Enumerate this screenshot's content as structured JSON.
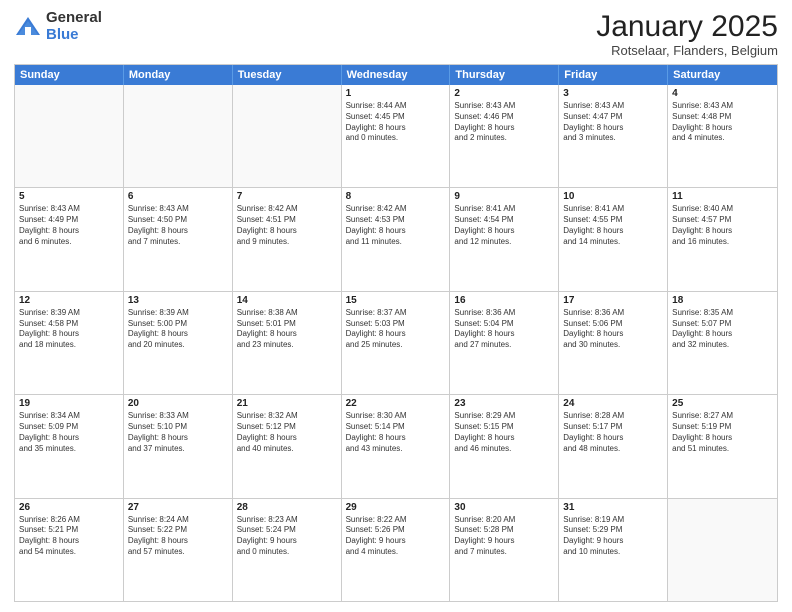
{
  "logo": {
    "general": "General",
    "blue": "Blue"
  },
  "header": {
    "month": "January 2025",
    "location": "Rotselaar, Flanders, Belgium"
  },
  "weekdays": [
    "Sunday",
    "Monday",
    "Tuesday",
    "Wednesday",
    "Thursday",
    "Friday",
    "Saturday"
  ],
  "weeks": [
    [
      {
        "day": "",
        "detail": ""
      },
      {
        "day": "",
        "detail": ""
      },
      {
        "day": "",
        "detail": ""
      },
      {
        "day": "1",
        "detail": "Sunrise: 8:44 AM\nSunset: 4:45 PM\nDaylight: 8 hours\nand 0 minutes."
      },
      {
        "day": "2",
        "detail": "Sunrise: 8:43 AM\nSunset: 4:46 PM\nDaylight: 8 hours\nand 2 minutes."
      },
      {
        "day": "3",
        "detail": "Sunrise: 8:43 AM\nSunset: 4:47 PM\nDaylight: 8 hours\nand 3 minutes."
      },
      {
        "day": "4",
        "detail": "Sunrise: 8:43 AM\nSunset: 4:48 PM\nDaylight: 8 hours\nand 4 minutes."
      }
    ],
    [
      {
        "day": "5",
        "detail": "Sunrise: 8:43 AM\nSunset: 4:49 PM\nDaylight: 8 hours\nand 6 minutes."
      },
      {
        "day": "6",
        "detail": "Sunrise: 8:43 AM\nSunset: 4:50 PM\nDaylight: 8 hours\nand 7 minutes."
      },
      {
        "day": "7",
        "detail": "Sunrise: 8:42 AM\nSunset: 4:51 PM\nDaylight: 8 hours\nand 9 minutes."
      },
      {
        "day": "8",
        "detail": "Sunrise: 8:42 AM\nSunset: 4:53 PM\nDaylight: 8 hours\nand 11 minutes."
      },
      {
        "day": "9",
        "detail": "Sunrise: 8:41 AM\nSunset: 4:54 PM\nDaylight: 8 hours\nand 12 minutes."
      },
      {
        "day": "10",
        "detail": "Sunrise: 8:41 AM\nSunset: 4:55 PM\nDaylight: 8 hours\nand 14 minutes."
      },
      {
        "day": "11",
        "detail": "Sunrise: 8:40 AM\nSunset: 4:57 PM\nDaylight: 8 hours\nand 16 minutes."
      }
    ],
    [
      {
        "day": "12",
        "detail": "Sunrise: 8:39 AM\nSunset: 4:58 PM\nDaylight: 8 hours\nand 18 minutes."
      },
      {
        "day": "13",
        "detail": "Sunrise: 8:39 AM\nSunset: 5:00 PM\nDaylight: 8 hours\nand 20 minutes."
      },
      {
        "day": "14",
        "detail": "Sunrise: 8:38 AM\nSunset: 5:01 PM\nDaylight: 8 hours\nand 23 minutes."
      },
      {
        "day": "15",
        "detail": "Sunrise: 8:37 AM\nSunset: 5:03 PM\nDaylight: 8 hours\nand 25 minutes."
      },
      {
        "day": "16",
        "detail": "Sunrise: 8:36 AM\nSunset: 5:04 PM\nDaylight: 8 hours\nand 27 minutes."
      },
      {
        "day": "17",
        "detail": "Sunrise: 8:36 AM\nSunset: 5:06 PM\nDaylight: 8 hours\nand 30 minutes."
      },
      {
        "day": "18",
        "detail": "Sunrise: 8:35 AM\nSunset: 5:07 PM\nDaylight: 8 hours\nand 32 minutes."
      }
    ],
    [
      {
        "day": "19",
        "detail": "Sunrise: 8:34 AM\nSunset: 5:09 PM\nDaylight: 8 hours\nand 35 minutes."
      },
      {
        "day": "20",
        "detail": "Sunrise: 8:33 AM\nSunset: 5:10 PM\nDaylight: 8 hours\nand 37 minutes."
      },
      {
        "day": "21",
        "detail": "Sunrise: 8:32 AM\nSunset: 5:12 PM\nDaylight: 8 hours\nand 40 minutes."
      },
      {
        "day": "22",
        "detail": "Sunrise: 8:30 AM\nSunset: 5:14 PM\nDaylight: 8 hours\nand 43 minutes."
      },
      {
        "day": "23",
        "detail": "Sunrise: 8:29 AM\nSunset: 5:15 PM\nDaylight: 8 hours\nand 46 minutes."
      },
      {
        "day": "24",
        "detail": "Sunrise: 8:28 AM\nSunset: 5:17 PM\nDaylight: 8 hours\nand 48 minutes."
      },
      {
        "day": "25",
        "detail": "Sunrise: 8:27 AM\nSunset: 5:19 PM\nDaylight: 8 hours\nand 51 minutes."
      }
    ],
    [
      {
        "day": "26",
        "detail": "Sunrise: 8:26 AM\nSunset: 5:21 PM\nDaylight: 8 hours\nand 54 minutes."
      },
      {
        "day": "27",
        "detail": "Sunrise: 8:24 AM\nSunset: 5:22 PM\nDaylight: 8 hours\nand 57 minutes."
      },
      {
        "day": "28",
        "detail": "Sunrise: 8:23 AM\nSunset: 5:24 PM\nDaylight: 9 hours\nand 0 minutes."
      },
      {
        "day": "29",
        "detail": "Sunrise: 8:22 AM\nSunset: 5:26 PM\nDaylight: 9 hours\nand 4 minutes."
      },
      {
        "day": "30",
        "detail": "Sunrise: 8:20 AM\nSunset: 5:28 PM\nDaylight: 9 hours\nand 7 minutes."
      },
      {
        "day": "31",
        "detail": "Sunrise: 8:19 AM\nSunset: 5:29 PM\nDaylight: 9 hours\nand 10 minutes."
      },
      {
        "day": "",
        "detail": ""
      }
    ]
  ]
}
